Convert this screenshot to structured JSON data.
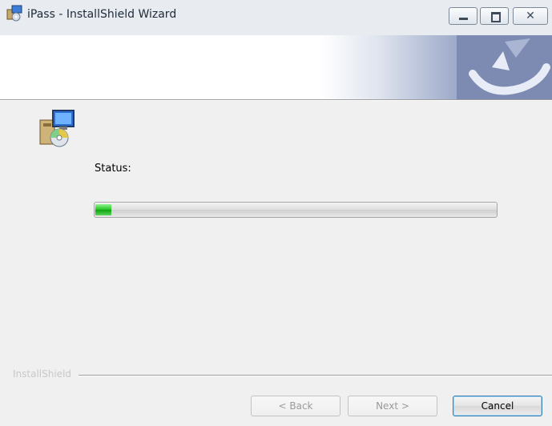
{
  "window": {
    "title": "iPass - InstallShield Wizard",
    "icon": "installer-icon",
    "controls": {
      "minimize": "minimize-icon",
      "maximize": "maximize-icon",
      "close": "close-icon"
    }
  },
  "header": {
    "logo": "installshield-logo",
    "banner_colors": [
      "#ffffff",
      "#7785ad"
    ]
  },
  "main": {
    "icon": "setup-computer-cd-icon",
    "status_label": "Status:",
    "progress": {
      "value": 0.04,
      "fill_color": "#22c322"
    }
  },
  "footer": {
    "brand": "InstallShield",
    "buttons": {
      "back": {
        "label": "< Back",
        "enabled": false
      },
      "next": {
        "label": "Next >",
        "enabled": false
      },
      "cancel": {
        "label": "Cancel",
        "enabled": true
      }
    }
  }
}
